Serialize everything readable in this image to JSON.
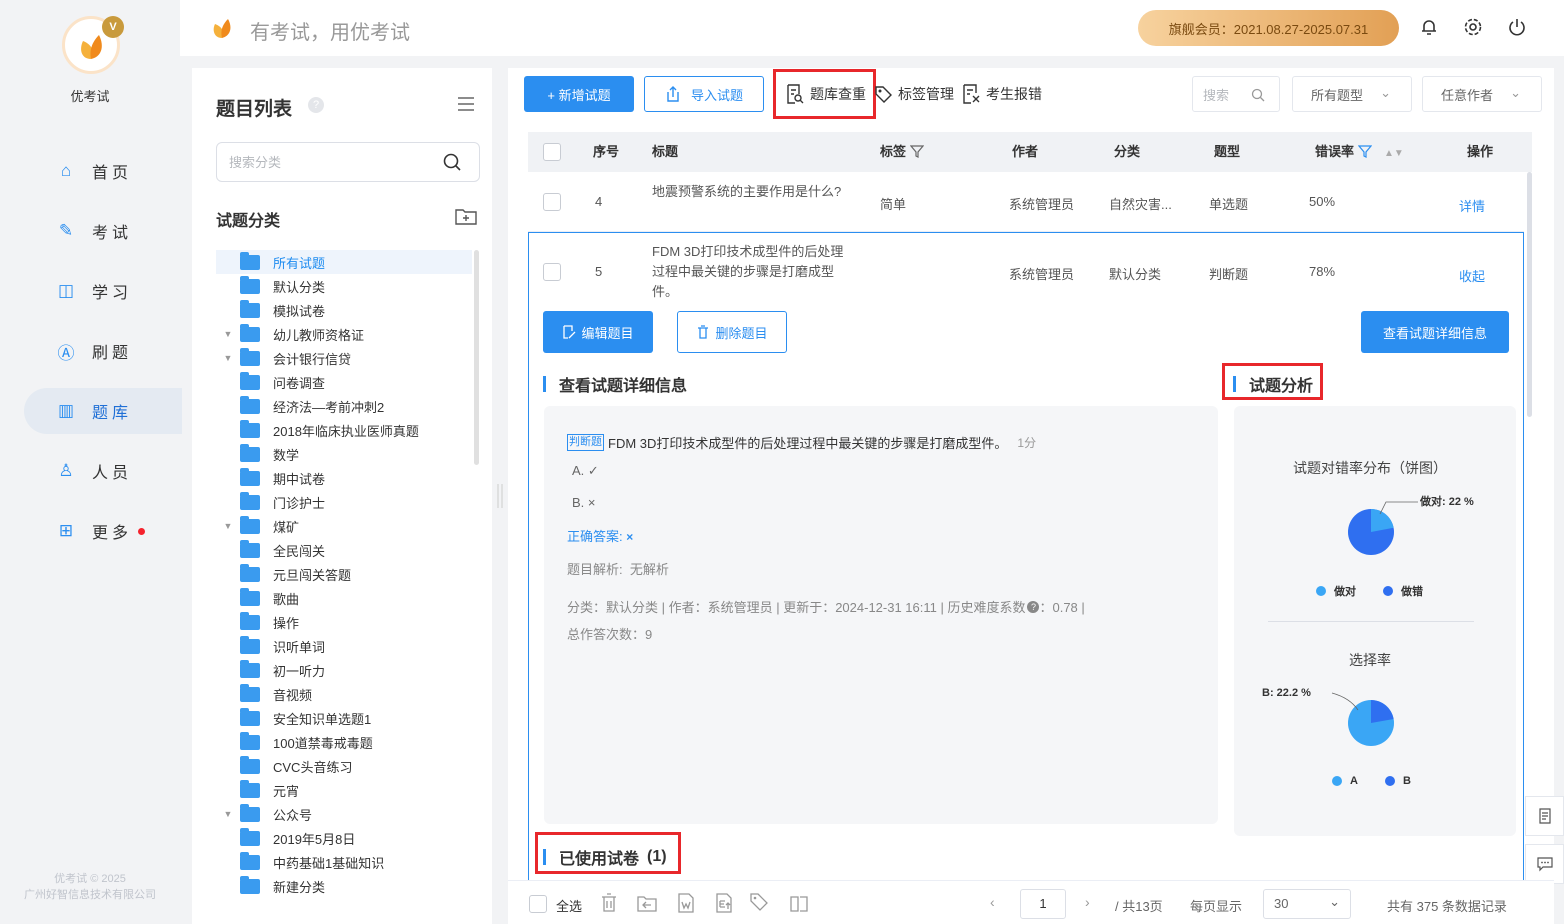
{
  "app": {
    "name": "优考试",
    "slogan": "有考试，用优考试",
    "badge": "V",
    "copyright_line1": "优考试 © 2025",
    "copyright_line2": "广州好智信息技术有限公司"
  },
  "header": {
    "membership": "旗舰会员：2021.08.27-2025.07.31",
    "icons": [
      "bell-icon",
      "gear-icon",
      "power-icon"
    ]
  },
  "nav": {
    "items": [
      {
        "label": "首页",
        "icon": "home-icon",
        "glyph": "⌂"
      },
      {
        "label": "考试",
        "icon": "pen-icon",
        "glyph": "✎"
      },
      {
        "label": "学习",
        "icon": "book-icon",
        "glyph": "◫"
      },
      {
        "label": "刷题",
        "icon": "a-icon",
        "glyph": "Ⓐ"
      },
      {
        "label": "题库",
        "icon": "bars-icon",
        "glyph": "▥"
      },
      {
        "label": "人员",
        "icon": "user-icon",
        "glyph": "♙"
      },
      {
        "label": "更多",
        "icon": "grid-icon",
        "glyph": "⊞"
      }
    ],
    "active_index": 4
  },
  "tree": {
    "title": "题目列表",
    "help": "?",
    "search_placeholder": "搜索分类",
    "category_title": "试题分类",
    "items": [
      {
        "label": "所有试题",
        "expandable": false
      },
      {
        "label": "默认分类",
        "expandable": false
      },
      {
        "label": "模拟试卷",
        "expandable": false
      },
      {
        "label": "幼儿教师资格证",
        "expandable": true
      },
      {
        "label": "会计银行信贷",
        "expandable": true
      },
      {
        "label": "问卷调查",
        "expandable": false
      },
      {
        "label": "经济法—考前冲刺2",
        "expandable": false
      },
      {
        "label": "2018年临床执业医师真题",
        "expandable": false
      },
      {
        "label": "数学",
        "expandable": false
      },
      {
        "label": "期中试卷",
        "expandable": false
      },
      {
        "label": "门诊护士",
        "expandable": false
      },
      {
        "label": "煤矿",
        "expandable": true
      },
      {
        "label": "全民闯关",
        "expandable": false
      },
      {
        "label": "元旦闯关答题",
        "expandable": false
      },
      {
        "label": "歌曲",
        "expandable": false
      },
      {
        "label": "操作",
        "expandable": false
      },
      {
        "label": "识听单词",
        "expandable": false
      },
      {
        "label": "初一听力",
        "expandable": false
      },
      {
        "label": "音视频",
        "expandable": false
      },
      {
        "label": "安全知识单选题1",
        "expandable": false
      },
      {
        "label": "100道禁毒戒毒题",
        "expandable": false
      },
      {
        "label": "CVC头音练习",
        "expandable": false
      },
      {
        "label": "元宵",
        "expandable": false
      },
      {
        "label": "公众号",
        "expandable": true
      },
      {
        "label": "2019年5月8日",
        "expandable": false
      },
      {
        "label": "中药基础1基础知识",
        "expandable": false
      },
      {
        "label": "新建分类",
        "expandable": false
      }
    ],
    "selected_index": 0
  },
  "toolbar": {
    "add": "+ 新增试题",
    "import": "导入试题",
    "dup_check": "题库查重",
    "tag_manage": "标签管理",
    "report": "考生报错",
    "search_placeholder": "搜索",
    "type_filter": "所有题型",
    "author_filter": "任意作者"
  },
  "table": {
    "headers": {
      "seq": "序号",
      "title": "标题",
      "tag": "标签",
      "author": "作者",
      "category": "分类",
      "type": "题型",
      "error_rate": "错误率",
      "action": "操作"
    },
    "rows": [
      {
        "seq": "4",
        "title": "地震预警系统的主要作用是什么?",
        "tag": "简单",
        "author": "系统管理员",
        "category": "自然灾害...",
        "type": "单选题",
        "error_rate": "50%",
        "action": "详情"
      },
      {
        "seq": "5",
        "title": "FDM 3D打印技术成型件的后处理过程中最关键的步骤是打磨成型件。",
        "tag": "",
        "author": "系统管理员",
        "category": "默认分类",
        "type": "判断题",
        "error_rate": "78%",
        "action": "收起"
      }
    ]
  },
  "detail": {
    "edit": "编辑题目",
    "delete": "删除题目",
    "view_detail": "查看试题详细信息",
    "section_title": "查看试题详细信息",
    "analysis_title": "试题分析",
    "type_tag": "判断题",
    "question": "FDM 3D打印技术成型件的后处理过程中最关键的步骤是打磨成型件。",
    "score": "1分",
    "option_a": "A. ✓",
    "option_b": "B. ×",
    "answer_label": "正确答案:",
    "answer_value": "×",
    "analysis_label": "题目解析:",
    "analysis_value": "无解析",
    "meta": "分类：默认分类 | 作者：系统管理员 | 更新于：2024-12-31 16:11 | 历史难度系数",
    "meta_value": "：0.78 |",
    "attempts": "总作答次数：9",
    "used_papers": "已使用试卷",
    "used_count": "(1)"
  },
  "analysis": {
    "chart1_title": "试题对错率分布（饼图）",
    "chart1_label": "做对: 22 %",
    "chart1_legend": [
      "做对",
      "做错"
    ],
    "chart2_title": "选择率",
    "chart2_label": "B: 22.2 %",
    "chart2_legend": [
      "A",
      "B"
    ],
    "colors": {
      "light": "#3aa6f5",
      "dark": "#2f6ff0"
    }
  },
  "footer": {
    "select_all": "全选",
    "page": "1",
    "total_pages": "/ 共13页",
    "per_page_label": "每页显示",
    "per_page": "30",
    "total": "共有 375 条数据记录"
  }
}
